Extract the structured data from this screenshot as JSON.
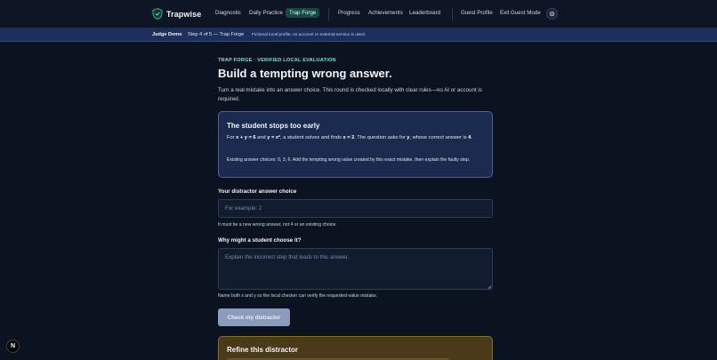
{
  "brand": {
    "name": "Trapwise"
  },
  "nav": {
    "items": [
      {
        "label": "Diagnostic"
      },
      {
        "label": "Daily Practice"
      },
      {
        "label": "Trap Forge"
      },
      {
        "label": "Progress"
      },
      {
        "label": "Achievements"
      },
      {
        "label": "Leaderboard"
      },
      {
        "label": "Guest Profile"
      },
      {
        "label": "Exit Guest Mode"
      }
    ],
    "active": "Trap Forge",
    "settings_icon": "gear-icon"
  },
  "demo_bar": {
    "title": "Judge Demo",
    "step": "Step 4 of 5 — Trap Forge",
    "note": "Fictional local profile; no account or external service is used."
  },
  "main": {
    "eyebrow": "TRAP FORGE · VERIFIED LOCAL EVALUATION",
    "title": "Build a tempting wrong answer.",
    "lede": "Turn a real mistake into an answer choice. This round is checked locally with clear rules—no AI or account is required."
  },
  "problem": {
    "title": "The student stops too early",
    "body_pre": "For ",
    "eq1": "x + y = 6",
    "and": " and ",
    "eq2": "y = x²",
    "mid": ", a student solves and finds ",
    "found": "x = 2",
    "asks": ". The question asks for ",
    "target": "y",
    "correct_pre": ", whose correct answer is ",
    "correct": "4",
    "end": ".",
    "note": "Existing answer choices: 0, 3, 6. Add the tempting wrong value created by this exact mistake, then explain the faulty step."
  },
  "form": {
    "answer_label": "Your distractor answer choice",
    "answer_placeholder": "For example: 2",
    "answer_value": "",
    "answer_help": "It must be a new wrong answer, not 4 or an existing choice.",
    "reason_label": "Why might a student choose it?",
    "reason_placeholder": "Explain the incorrect step that leads to this answer.",
    "reason_value": "",
    "reason_help": "Name both x and y so the local checker can verify the requested-value mistake.",
    "submit_label": "Check my distractor"
  },
  "refine": {
    "title": "Refine this distractor"
  },
  "dev_badge": {
    "label": "N"
  },
  "colors": {
    "background": "#0b1220",
    "accent_teal": "#5eead4",
    "card_blue": "#1b2b4f",
    "refine_amber": "#4a3a1a",
    "demo_bar": "#1d2f5c"
  }
}
